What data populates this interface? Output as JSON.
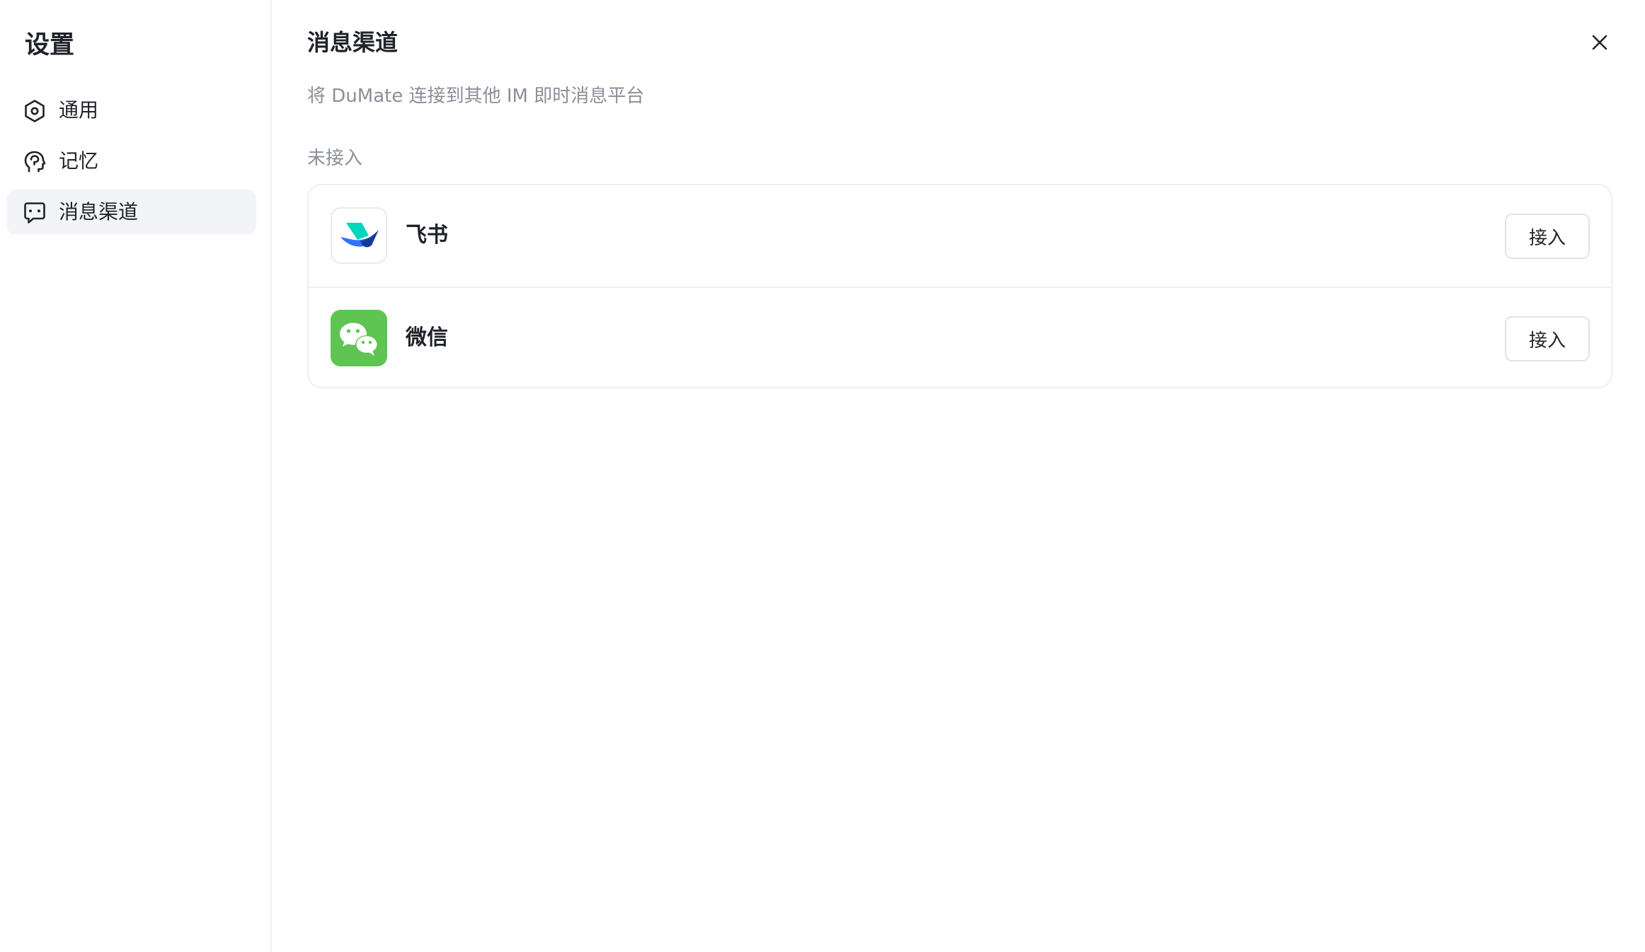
{
  "sidebar": {
    "title": "设置",
    "items": [
      {
        "label": "通用",
        "icon": "settings-hexagon-icon",
        "active": false
      },
      {
        "label": "记忆",
        "icon": "brain-head-icon",
        "active": false
      },
      {
        "label": "消息渠道",
        "icon": "message-chat-icon",
        "active": true
      }
    ]
  },
  "main": {
    "title": "消息渠道",
    "subtitle": "将 DuMate 连接到其他 IM 即时消息平台",
    "section_label": "未接入",
    "channels": [
      {
        "name": "飞书",
        "icon": "feishu-logo-icon",
        "button_label": "接入"
      },
      {
        "name": "微信",
        "icon": "wechat-logo-icon",
        "button_label": "接入"
      }
    ]
  },
  "colors": {
    "active_nav_bg": "#f2f4f8",
    "wechat_green": "#5ec552",
    "muted_text": "#8a8f99",
    "feishu_blue": "#3370ff",
    "feishu_teal": "#00d6b9",
    "feishu_navy": "#133c9a"
  }
}
